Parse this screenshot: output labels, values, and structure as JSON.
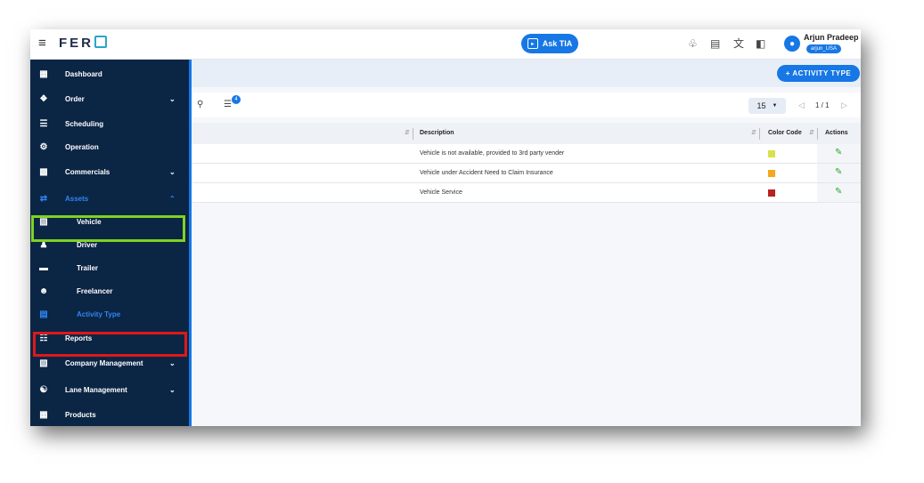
{
  "header": {
    "logo": "FERO",
    "ask_label": "Ask TIA",
    "user_name": "Arjun Pradeep",
    "user_badge": "arjun_USA"
  },
  "sidebar": {
    "items": [
      {
        "label": "Dashboard"
      },
      {
        "label": "Order"
      },
      {
        "label": "Scheduling"
      },
      {
        "label": "Operation"
      },
      {
        "label": "Commercials"
      },
      {
        "label": "Assets"
      },
      {
        "label": "Vehicle"
      },
      {
        "label": "Driver"
      },
      {
        "label": "Trailer"
      },
      {
        "label": "Freelancer"
      },
      {
        "label": "Activity Type"
      },
      {
        "label": "Reports"
      },
      {
        "label": "Company Management"
      },
      {
        "label": "Lane Management"
      },
      {
        "label": "Products"
      }
    ]
  },
  "toolbar": {
    "add_label": "+ ACTIVITY TYPE",
    "filter_count": "4",
    "page_size": "15",
    "page_info": "1 / 1"
  },
  "table": {
    "columns": [
      "Description",
      "Color Code",
      "Actions"
    ],
    "rows": [
      {
        "description": "Vehicle is not available, provided to 3rd party vender",
        "color": "#d9e04a"
      },
      {
        "description": "Vehicle under Accident Need to Claim Insurance",
        "color": "#f4a81d"
      },
      {
        "description": "Vehicle Service",
        "color": "#b8211f"
      }
    ]
  },
  "colors": {
    "sidebar_bg": "#0b2545",
    "accent": "#1677e5",
    "highlight_green": "#7ed321",
    "highlight_red": "#e01818"
  }
}
